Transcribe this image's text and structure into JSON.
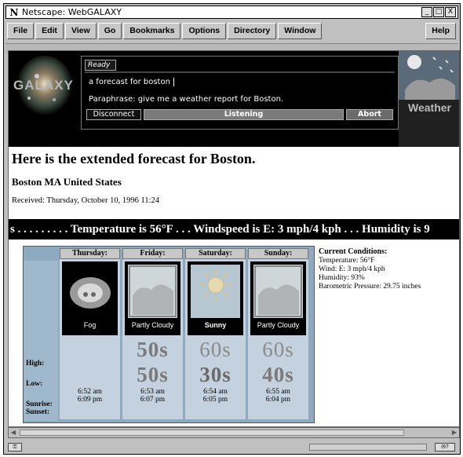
{
  "window": {
    "logo": "N",
    "title": "Netscape: WebGALAXY",
    "controls": [
      "_",
      "□",
      "X"
    ]
  },
  "menu": [
    "File",
    "Edit",
    "View",
    "Go",
    "Bookmarks",
    "Options",
    "Directory",
    "Window"
  ],
  "menu_help": "Help",
  "galaxy": {
    "logo_text": "GALAXY",
    "status": "Ready",
    "query": "a forecast for boston",
    "paraphrase": "Paraphrase: give me a weather report for Boston.",
    "disconnect": "Disconnect",
    "listening": "Listening",
    "abort": "Abort",
    "domain_tile": "Weather"
  },
  "page": {
    "headline": "Here is the extended forecast for Boston.",
    "location": "Boston MA United States",
    "received": "Received: Thursday, October 10, 1996 11:24",
    "marquee": "s . . . . . . . . . Temperature is 56°F . . . Windspeed is E: 3 mph/4 kph . . . Humidity is 9"
  },
  "forecast": {
    "row_labels": {
      "high": "High:",
      "low": "Low:",
      "sunrise": "Sunrise:",
      "sunset": "Sunset:"
    },
    "days": [
      {
        "day": "Thursday:",
        "condition": "Fog",
        "icon": "fog-icon",
        "high": "",
        "low": "",
        "sunrise": "6:52 am",
        "sunset": "6:09 pm"
      },
      {
        "day": "Friday:",
        "condition": "Partly Cloudy",
        "icon": "partly-cloudy-icon",
        "high": "50s",
        "low": "50s",
        "sunrise": "6:53 am",
        "sunset": "6:07 pm"
      },
      {
        "day": "Saturday:",
        "condition": "Sunny",
        "icon": "sunny-icon",
        "high": "60s",
        "low": "30s",
        "sunrise": "6:54 am",
        "sunset": "6:05 pm"
      },
      {
        "day": "Sunday:",
        "condition": "Partly Cloudy",
        "icon": "partly-cloudy-icon",
        "high": "60s",
        "low": "40s",
        "sunrise": "6:55 am",
        "sunset": "6:04 pm"
      }
    ]
  },
  "current": {
    "title": "Current Conditions:",
    "temperature": "Temperature: 56°F",
    "wind": "Wind: E: 3 mph/4 kph",
    "humidity": "Humidity: 93%",
    "pressure": "Barometric Pressure: 29.75 inches"
  },
  "colors": {
    "banner": "#000000",
    "table_bg": "#8eaac0",
    "temp_text": "#7a7a7a"
  }
}
